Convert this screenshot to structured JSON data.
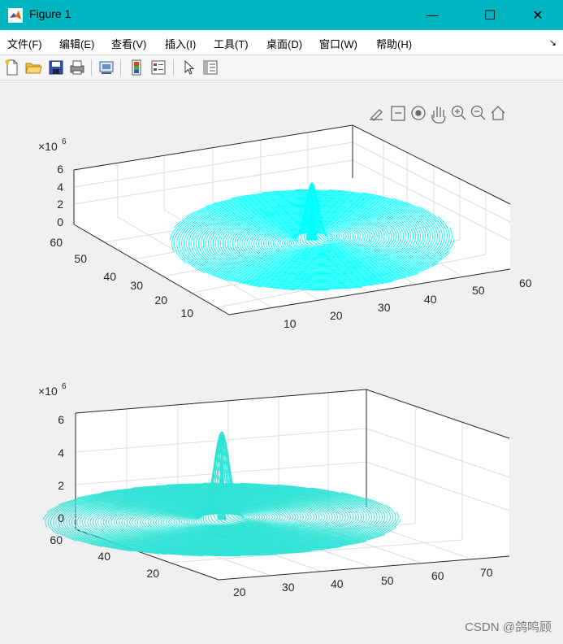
{
  "window": {
    "title": "Figure 1",
    "minimize_glyph": "—",
    "maximize_glyph": "☐",
    "close_glyph": "✕"
  },
  "menu": [
    {
      "label": "文件(F)"
    },
    {
      "label": "编辑(E)"
    },
    {
      "label": "查看(V)"
    },
    {
      "label": "插入(I)"
    },
    {
      "label": "工具(T)"
    },
    {
      "label": "桌面(D)"
    },
    {
      "label": "窗口(W)"
    },
    {
      "label": "帮助(H)"
    }
  ],
  "menu_overflow_glyph": "↘",
  "toolbar": {
    "icons": [
      "new-figure-icon",
      "open-file-icon",
      "save-icon",
      "print-icon",
      "link-plot-icon",
      "insert-colorbar-icon",
      "insert-legend-icon",
      "edit-plot-arrow-icon",
      "property-inspector-icon"
    ]
  },
  "axes_toolbar": {
    "icons": [
      "brush-icon",
      "data-tips-icon",
      "rotate-3d-icon",
      "pan-hand-icon",
      "zoom-in-icon",
      "zoom-out-icon",
      "home-icon"
    ]
  },
  "colors": {
    "titlebar": "#00b5c0",
    "surface_top": "#00ffff",
    "surface_bottom": "#2fe3d6",
    "axis": "#262626",
    "grid": "#dddddd"
  },
  "chart_data": [
    {
      "type": "line3d",
      "description_series": "spiral streamlines converging to central spike",
      "exponent_label": "×10",
      "exponent_power": "6",
      "z_ticks": [
        "0",
        "2",
        "4",
        "6"
      ],
      "x_ticks": [
        "10",
        "20",
        "30",
        "40",
        "50",
        "60"
      ],
      "y_ticks": [
        "10",
        "20",
        "30",
        "40",
        "50",
        "60"
      ],
      "zlim": [
        0,
        6000000
      ],
      "peak": 5000000
    },
    {
      "type": "line3d",
      "description_series": "spiral streamlines converging to central spike",
      "exponent_label": "×10",
      "exponent_power": "6",
      "z_ticks": [
        "0",
        "2",
        "4",
        "6"
      ],
      "x_ticks": [
        "20",
        "30",
        "40",
        "50",
        "60",
        "70"
      ],
      "y_ticks": [
        "20",
        "40",
        "60"
      ],
      "zlim": [
        0,
        6000000
      ],
      "peak": 5000000
    }
  ],
  "watermark": "CSDN @鸽鸣顾"
}
